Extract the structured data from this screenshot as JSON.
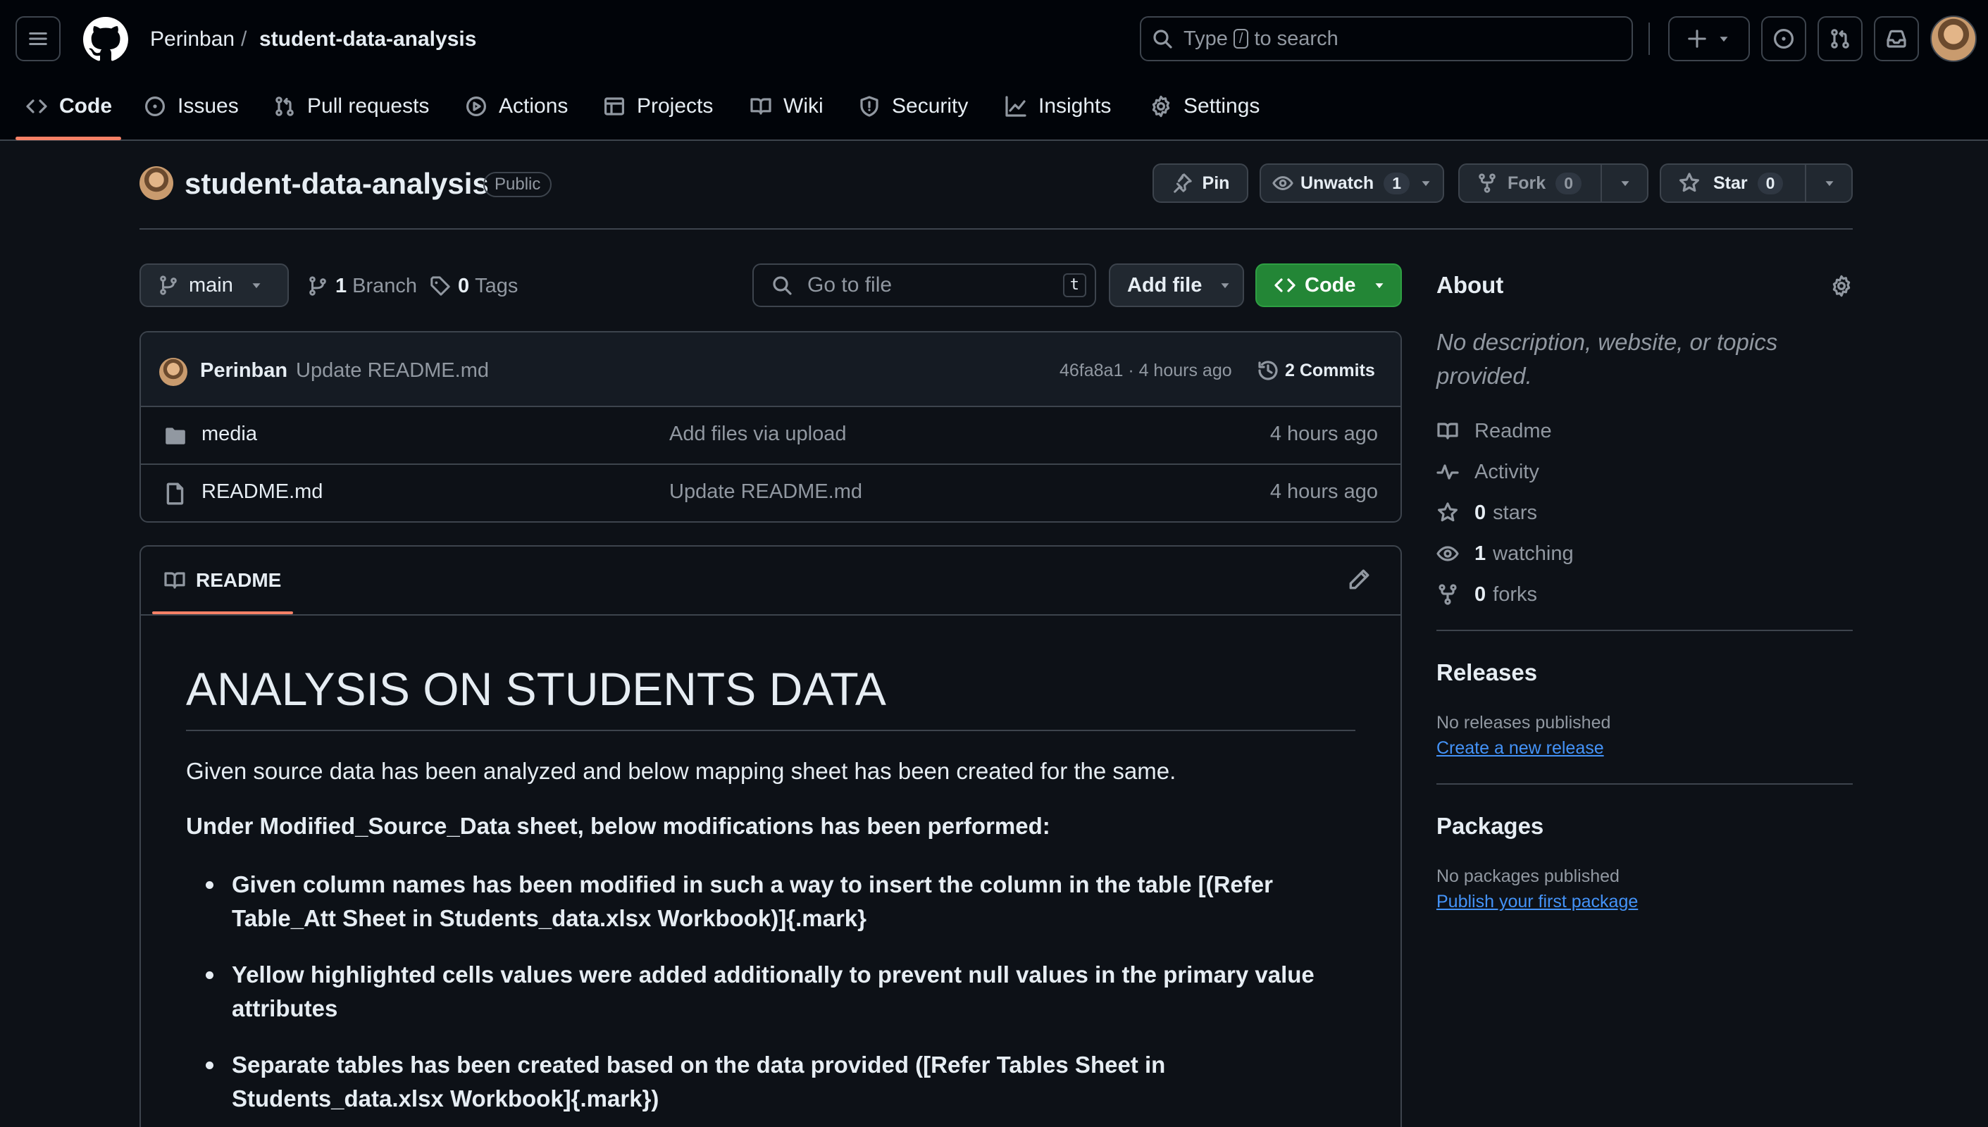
{
  "header": {
    "owner": "Perinban",
    "separator": "/",
    "repo": "student-data-analysis",
    "search_prefix": "Type",
    "search_key": "/",
    "search_suffix": "to search"
  },
  "nav": {
    "tabs": [
      {
        "label": "Code"
      },
      {
        "label": "Issues"
      },
      {
        "label": "Pull requests"
      },
      {
        "label": "Actions"
      },
      {
        "label": "Projects"
      },
      {
        "label": "Wiki"
      },
      {
        "label": "Security"
      },
      {
        "label": "Insights"
      },
      {
        "label": "Settings"
      }
    ]
  },
  "repo": {
    "name": "student-data-analysis",
    "visibility": "Public",
    "pin_label": "Pin",
    "unwatch_label": "Unwatch",
    "watch_count": "1",
    "fork_label": "Fork",
    "fork_count": "0",
    "star_label": "Star",
    "star_count": "0"
  },
  "branchbar": {
    "branch": "main",
    "branches_count": "1",
    "branches_label": "Branch",
    "tags_count": "0",
    "tags_label": "Tags",
    "goto_placeholder": "Go to file",
    "goto_key": "t",
    "add_file": "Add file",
    "code_button": "Code"
  },
  "commit": {
    "author": "Perinban",
    "message": "Update README.md",
    "hash_time": "46fa8a1 · 4 hours ago",
    "commits_count": "2",
    "commits_label": "Commits"
  },
  "files": [
    {
      "name": "media",
      "type": "folder",
      "message": "Add files via upload",
      "time": "4 hours ago"
    },
    {
      "name": "README.md",
      "type": "file",
      "message": "Update README.md",
      "time": "4 hours ago"
    }
  ],
  "readme": {
    "tab_label": "README",
    "title": "ANALYSIS ON STUDENTS DATA",
    "paragraph": "Given source data has been analyzed and below mapping sheet has been created for the same.",
    "subheading": "Under Modified_Source_Data sheet, below modifications has been performed:",
    "bullets": [
      "Given column names has been modified in such a way to insert the column in the table [(Refer Table_Att Sheet in Students_data.xlsx Workbook)]{.mark}",
      "Yellow highlighted cells values were added additionally to prevent null values in the primary value attributes",
      "Separate tables has been created based on the data provided ([Refer Tables Sheet in Students_data.xlsx Workbook]{.mark})"
    ]
  },
  "about": {
    "heading": "About",
    "description": "No description, website, or topics provided.",
    "readme": "Readme",
    "activity": "Activity",
    "stars_count": "0",
    "stars_label": "stars",
    "watching_count": "1",
    "watching_label": "watching",
    "forks_count": "0",
    "forks_label": "forks"
  },
  "releases": {
    "heading": "Releases",
    "empty": "No releases published",
    "link": "Create a new release"
  },
  "packages": {
    "heading": "Packages",
    "empty": "No packages published",
    "link": "Publish your first package"
  },
  "colors": {
    "bg": "#0d1117",
    "header_bg": "#010409",
    "border": "#3d444d",
    "accent_tab": "#f78166",
    "green": "#238636",
    "link": "#4493f8",
    "muted": "#9198a1"
  }
}
